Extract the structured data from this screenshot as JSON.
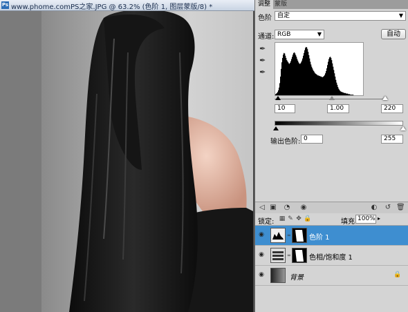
{
  "document": {
    "title": "www.phome.comPS之家.JPG @ 63.2% (色阶 1, 图层蒙版/8) *",
    "app_icon_label": "Ps"
  },
  "adjustments": {
    "tabs": [
      "调整",
      "蒙版"
    ],
    "preset_label": "色阶",
    "preset_value": "自定",
    "channel_label": "通道:",
    "channel_value": "RGB",
    "auto_label": "自动",
    "input_levels": {
      "black": "10",
      "gamma": "1.00",
      "white": "220"
    },
    "output_label": "输出色阶:",
    "output_levels": {
      "black": "0",
      "white": "255"
    },
    "histogram_shape": [
      2,
      3,
      4,
      6,
      9,
      14,
      22,
      34,
      48,
      60,
      68,
      74,
      77,
      76,
      72,
      68,
      64,
      62,
      60,
      58,
      57,
      59,
      62,
      66,
      70,
      74,
      77,
      78,
      76,
      73,
      70,
      66,
      63,
      60,
      58,
      57,
      58,
      60,
      63,
      67,
      72,
      77,
      82,
      86,
      88,
      87,
      84,
      79,
      73,
      67,
      61,
      56,
      52,
      49,
      46,
      44,
      42,
      40,
      39,
      38,
      37,
      36,
      36,
      35,
      35,
      34,
      34,
      33,
      33,
      34,
      35,
      37,
      40,
      44,
      49,
      55,
      61,
      66,
      69,
      70,
      68,
      64,
      58,
      52,
      46,
      40,
      34,
      28,
      23,
      19,
      15,
      12,
      10,
      8,
      7,
      6,
      6,
      5,
      5,
      4,
      4,
      4,
      3,
      3,
      3,
      2,
      2,
      2,
      1,
      1,
      1,
      1,
      1,
      0,
      0,
      0,
      0,
      0,
      0,
      0,
      0,
      0,
      0,
      0,
      0,
      0,
      0
    ]
  },
  "layers": {
    "lock_label": "锁定:",
    "fill_label": "填充:",
    "fill_value": "100%",
    "items": [
      {
        "name": "色阶 1",
        "active": true
      },
      {
        "name": "色相/饱和度 1",
        "active": false
      },
      {
        "name": "背景",
        "active": false
      }
    ]
  },
  "colors": {
    "active_layer": "#3e8ed0",
    "panel_bg": "#d4d4d4"
  }
}
